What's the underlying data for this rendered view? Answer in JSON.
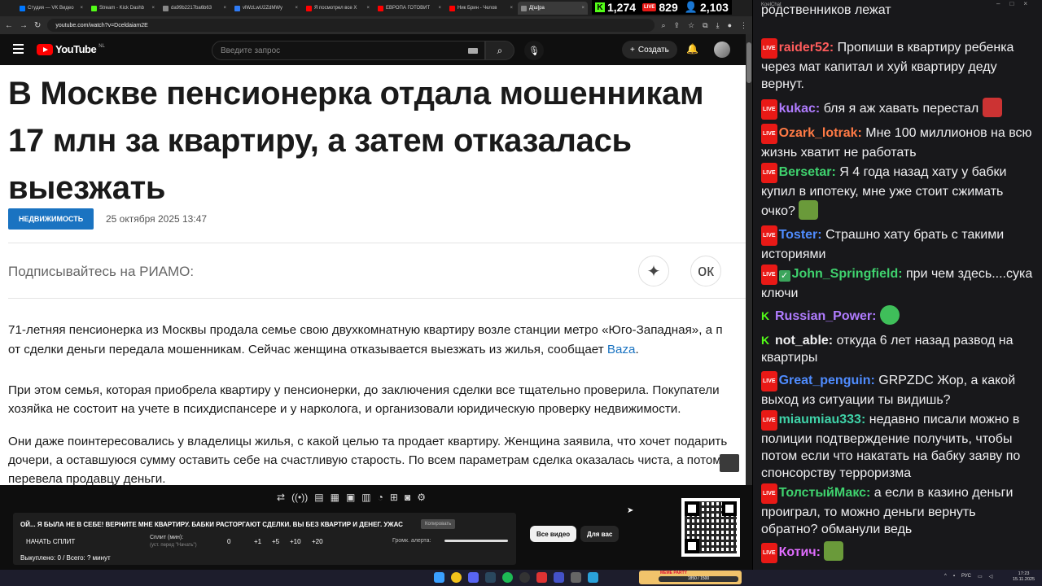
{
  "browser": {
    "tabs": [
      {
        "label": "Студия — VK Видео",
        "color": "#0077ff"
      },
      {
        "label": "Stream - Kick Dashb",
        "color": "#53fc18"
      },
      {
        "label": "da99b2217ba6b63",
        "color": "#888888"
      },
      {
        "label": "vlWzLwU2ZdMWy",
        "color": "#2f7bf5"
      },
      {
        "label": "Я посмотрел все Х",
        "color": "#ff0000"
      },
      {
        "label": "ЕВРОПА ГОТОВИТ",
        "color": "#ff0000"
      },
      {
        "label": "Ник Брин - Челов",
        "color": "#ff0000"
      },
      {
        "label": "Д[ш]ра",
        "color": "#888888",
        "active": true
      }
    ],
    "url": "youtube.com/watch?v=Dceldaiam2E"
  },
  "stream_stats": {
    "kick_viewers": "1,274",
    "vk_viewers": "829",
    "vk_badge": "LIVE",
    "total_viewers": "2,103"
  },
  "youtube": {
    "logo_text": "YouTube",
    "region": "NL",
    "search_placeholder": "Введите запрос",
    "create_label": "Создать"
  },
  "article": {
    "headline": "В Москве пенсионерка отдала мошенникам 17 млн за квартиру, а затем отказалась выезжать",
    "tag": "НЕДВИЖИМОСТЬ",
    "date": "25 октября 2025 13:47",
    "subscribe": "Подписывайтесь на РИАМО:",
    "p1_line1": "71-летняя пенсионерка из Москвы продала семье свою двухкомнатную квартиру возле станции метро «Юго-Западная», а п",
    "p1_line2": "от сделки деньги передала мошенникам. Сейчас женщина отказывается выезжать из жилья, сообщает ",
    "p1_link": "Baza",
    "p1_end": ".",
    "p2_line1": "При этом семья, которая приобрела квартиру у пенсионерки, до заключения сделки все тщательно проверила. Покупатели",
    "p2_line2": "хозяйка не состоит на учете в психдиспансере и у нарколога, и организовали юридическую проверку недвижимости.",
    "p3_line1": "Они даже поинтересовались у владелицы жилья, с какой целью та продает квартиру. Женщина заявила, что хочет подарить",
    "p3_line2": "дочери, а оставшуюся сумму оставить себе на счастливую старость. По всем параметрам сделка оказалась чиста, а потому",
    "p3_line3": "перевела продавцу деньги."
  },
  "timer_panel": {
    "title": "ОЙ... Я БЫЛА НЕ В СЕБЕ! ВЕРНИТЕ МНЕ КВАРТИРУ. БАБКИ РАСТОРГАЮТ СДЕЛКИ. ВЫ БЕЗ КВАРТИР И ДЕНЕГ. УЖАС",
    "copy_label": "Копировать",
    "start_split": "НАЧАТЬ СПЛИТ",
    "split_label": "Сплит (мин):",
    "split_hint": "(уст. перед \"Начать\")",
    "split_value": "0",
    "increments": [
      "+1",
      "+5",
      "+10",
      "+20"
    ],
    "alert_volume": "Громк. алерта:",
    "done": "Выкуплено: 0 / Всего: ? минут"
  },
  "yt_chips": {
    "all": "Все видео",
    "for_you": "Для вас"
  },
  "taskbar": {
    "meme_label": "MEME PARTY",
    "meme_progress": "1850 / 1500",
    "lang": "РУС",
    "time": "17:23",
    "date": "15.11.2025"
  },
  "chat": {
    "window_title": "KoelChat",
    "messages": [
      {
        "platform": "",
        "user": "",
        "color": "#efeff1",
        "text": "родственников лежат"
      },
      {
        "platform": "vk",
        "user": "raider52:",
        "color": "#ff5c5c",
        "text": "Пропиши в квартиру ребенка через мат капитал и хуй квартиру деду вернут."
      },
      {
        "platform": "vk",
        "user": "kukac:",
        "color": "#b07cff",
        "text": "бля я аж хавать перестал"
      },
      {
        "platform": "vk",
        "user": "Ozark_lotrak:",
        "color": "#ff7a45",
        "text": "Мне 100 миллионов на всю жизнь хватит не работать"
      },
      {
        "platform": "vk",
        "user": "Bersetar:",
        "color": "#3fd26e",
        "text": "Я 4 года назад хату у бабки купил в ипотеку, мне уже стоит сжимать очко?"
      },
      {
        "platform": "vk",
        "user": "Toster:",
        "color": "#4f8cff",
        "text": "Страшно хату брать с такими историями"
      },
      {
        "platform": "vk",
        "user": "John_Springfield:",
        "color": "#3fd26e",
        "text": "при чем здесь....сука ключи"
      },
      {
        "platform": "kick",
        "user": "Russian_Power:",
        "color": "#b07cff",
        "text": ""
      },
      {
        "platform": "kick",
        "user": "not_able:",
        "color": "#efeff1",
        "text": "откуда 6 лет назад развод на квартиры"
      },
      {
        "platform": "vk",
        "user": "Great_penguin:",
        "color": "#4f8cff",
        "text": "GRPZDC Жор, а какой выход из ситуации ты видишь?"
      },
      {
        "platform": "vk",
        "user": "miaumiau333:",
        "color": "#3fd2a8",
        "text": "недавно писали можно в полиции подтверждение получить, чтобы потом если что накатать на бабку заяву по спонсорству терроризма"
      },
      {
        "platform": "vk",
        "user": "ТолстыйМакс:",
        "color": "#3fd26e",
        "text": "а если в казино деньги проиграл, то можно деньги вернуть обратно? обманули ведь"
      },
      {
        "platform": "vk",
        "user": "Котич:",
        "color": "#e06cff",
        "text": ""
      }
    ]
  }
}
